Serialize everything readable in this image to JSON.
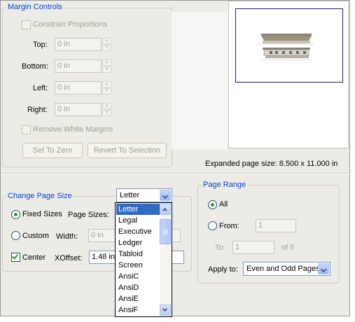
{
  "margin_controls": {
    "title": "Margin Controls",
    "constrain_proportions": "Constrain Proportions",
    "top_label": "Top:",
    "top_value": "0 in",
    "bottom_label": "Bottom:",
    "bottom_value": "0 in",
    "left_label": "Left:",
    "left_value": "0 in",
    "right_label": "Right:",
    "right_value": "0 in",
    "remove_white_margins": "Remove White Margins",
    "set_to_zero": "Set To Zero",
    "revert_to_selection": "Revert To Selection"
  },
  "preview": {
    "expanded_page_size": "Expanded page size: 8.500 x 11.000 in"
  },
  "change_page_size": {
    "title": "Change Page Size",
    "fixed_sizes": "Fixed Sizes",
    "fixed_sizes_selected": true,
    "page_sizes_label": "Page Sizes:",
    "page_sizes_value": "Letter",
    "custom": "Custom",
    "width_label": "Width:",
    "width_value": "0 in",
    "center": "Center",
    "center_checked": true,
    "xoffset_label": "XOffset:",
    "xoffset_value": "1.48 in"
  },
  "page_sizes_list": {
    "items": [
      "Letter",
      "Legal",
      "Executive",
      "Ledger",
      "Tabloid",
      "Screen",
      "AnsiC",
      "AnsiD",
      "AnsiE",
      "AnsiF"
    ],
    "selected": "Letter"
  },
  "page_range": {
    "title": "Page Range",
    "all": "All",
    "all_selected": true,
    "from": "From:",
    "from_value": "1",
    "to": "To:",
    "to_value": "1",
    "of": "of 5",
    "apply_to_label": "Apply to:",
    "apply_to_value": "Even and Odd Pages"
  },
  "colors": {
    "dialog_bg": "#ecebe5",
    "group_title": "#0046d5",
    "selection": "#316ac5",
    "disabled_text": "#a1a192"
  }
}
